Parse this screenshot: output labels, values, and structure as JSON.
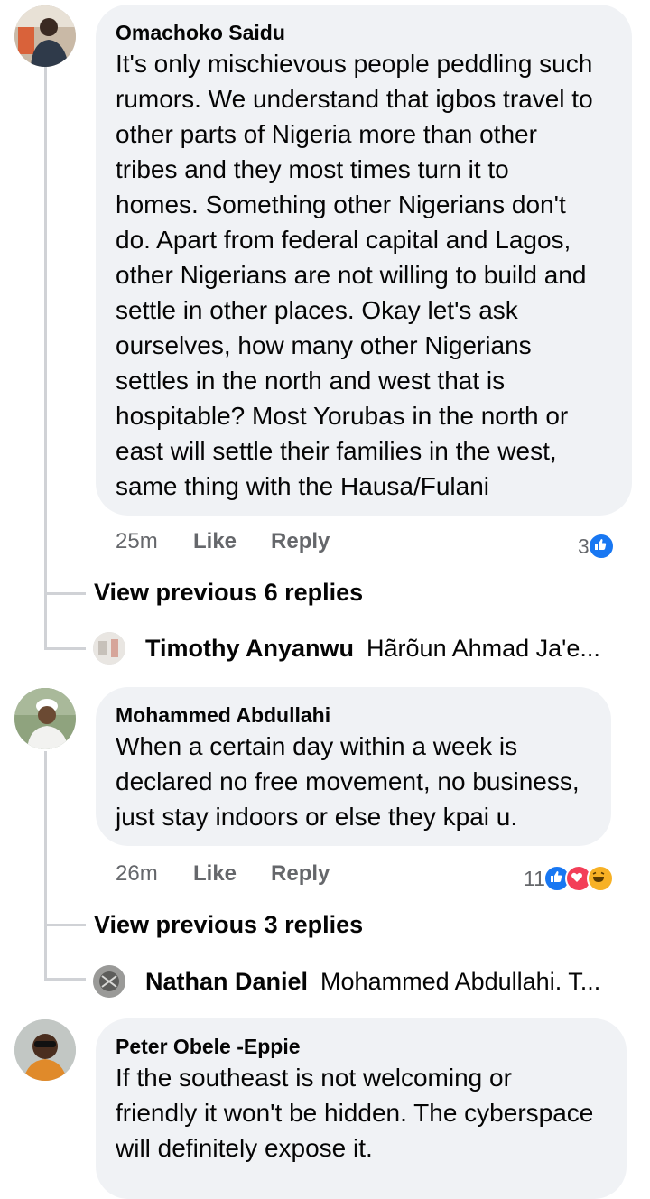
{
  "comments": [
    {
      "author": "Omachoko Saidu",
      "text": "It's only mischievous people peddling such\nrumors. We understand that igbos travel to\nother parts of Nigeria more than other\ntribes and they most times turn it to\nhomes. Something other Nigerians don't\ndo. Apart from federal capital and Lagos,\nother Nigerians are not willing to build and\nsettle in other places. Okay let's ask\nourselves, how many other Nigerians\nsettles in the north and west that is\nhospitable? Most Yorubas in the north or\neast will settle their families in the west,\nsame thing with the Hausa/Fulani",
      "time": "25m",
      "like_label": "Like",
      "reply_label": "Reply",
      "reaction_count": "3",
      "reactions": [
        "like-icon"
      ],
      "view_previous": "View previous 6 replies",
      "last_reply": {
        "author": "Timothy Anyanwu",
        "preview": "Hãrõun Ahmad Ja'e..."
      }
    },
    {
      "author": "Mohammed Abdullahi",
      "text": "When a certain day within a week is\ndeclared no free movement, no business,\njust stay indoors or else they kpai u.",
      "time": "26m",
      "like_label": "Like",
      "reply_label": "Reply",
      "reaction_count": "11",
      "reactions": [
        "like-icon",
        "love-icon",
        "haha-icon"
      ],
      "view_previous": "View previous 3 replies",
      "last_reply": {
        "author": "Nathan Daniel",
        "preview": "Mohammed Abdullahi. T..."
      }
    },
    {
      "author": "Peter Obele -Eppie",
      "text": "If the southeast is not welcoming or\nfriendly it won't be hidden. The cyberspace\nwill definitely expose it."
    }
  ],
  "colors": {
    "bubble": "#f0f2f5",
    "like_blue": "#1877f2",
    "love_red": "#f33e58",
    "haha_yellow": "#f7b125",
    "meta_grey": "#65676b"
  }
}
